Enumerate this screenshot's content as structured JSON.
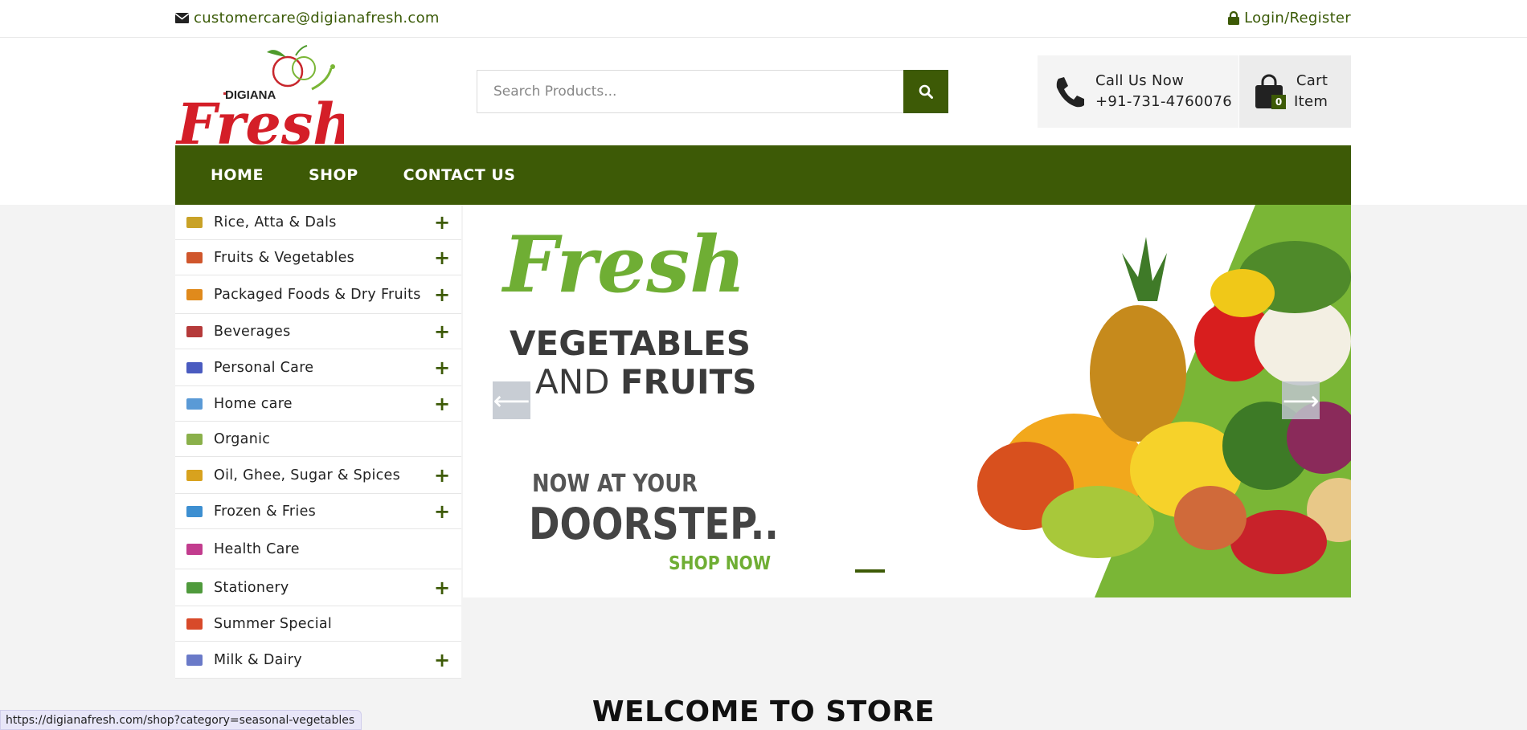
{
  "topbar": {
    "email": "customercare@digianafresh.com",
    "login": "Login/Register"
  },
  "logo": {
    "brand_small": "DIGIANA",
    "brand_big": "Fresh"
  },
  "search": {
    "placeholder": "Search Products..."
  },
  "call": {
    "title": "Call Us Now",
    "phone": "+91-731-4760076"
  },
  "cart": {
    "title": "Cart",
    "subtitle": "Item",
    "count": "0"
  },
  "nav": {
    "items": [
      "HOME",
      "SHOP",
      "CONTACT US"
    ]
  },
  "categories": [
    {
      "label": "Rice, Atta & Dals",
      "expandable": true,
      "color": "#c9a227"
    },
    {
      "label": "Fruits & Vegetables",
      "expandable": true,
      "color": "#d0562c"
    },
    {
      "label": "Packaged Foods & Dry Fruits",
      "expandable": true,
      "color": "#e08a1c"
    },
    {
      "label": "Beverages",
      "expandable": true,
      "color": "#b53a3a"
    },
    {
      "label": "Personal Care",
      "expandable": true,
      "color": "#4a5bc0"
    },
    {
      "label": "Home care",
      "expandable": true,
      "color": "#5a9ad6"
    },
    {
      "label": "Organic",
      "expandable": false,
      "color": "#8ab04a"
    },
    {
      "label": "Oil, Ghee, Sugar & Spices",
      "expandable": true,
      "color": "#d8a21e"
    },
    {
      "label": "Frozen & Fries",
      "expandable": true,
      "color": "#3d8fd1"
    },
    {
      "label": "Health Care",
      "expandable": false,
      "color": "#c23c8e"
    },
    {
      "label": "Stationery",
      "expandable": true,
      "color": "#4f9a3c"
    },
    {
      "label": "Summer Special",
      "expandable": false,
      "color": "#d84a2a"
    },
    {
      "label": "Milk & Dairy",
      "expandable": true,
      "color": "#6a7ac8"
    }
  ],
  "banner": {
    "headline": "Fresh",
    "line1": "VEGETABLES",
    "line2_a": "AND",
    "line2_b": "FRUITS",
    "tag1": "NOW AT YOUR",
    "tag2": "DOORSTEP..",
    "cta": "SHOP NOW",
    "prev": "⟵",
    "next": "⟶"
  },
  "welcome": "WELCOME TO STORE",
  "status_url": "https://digianafresh.com/shop?category=seasonal-vegetables",
  "colors": {
    "brand_green": "#3d5a06",
    "accent_green": "#7ab636"
  }
}
